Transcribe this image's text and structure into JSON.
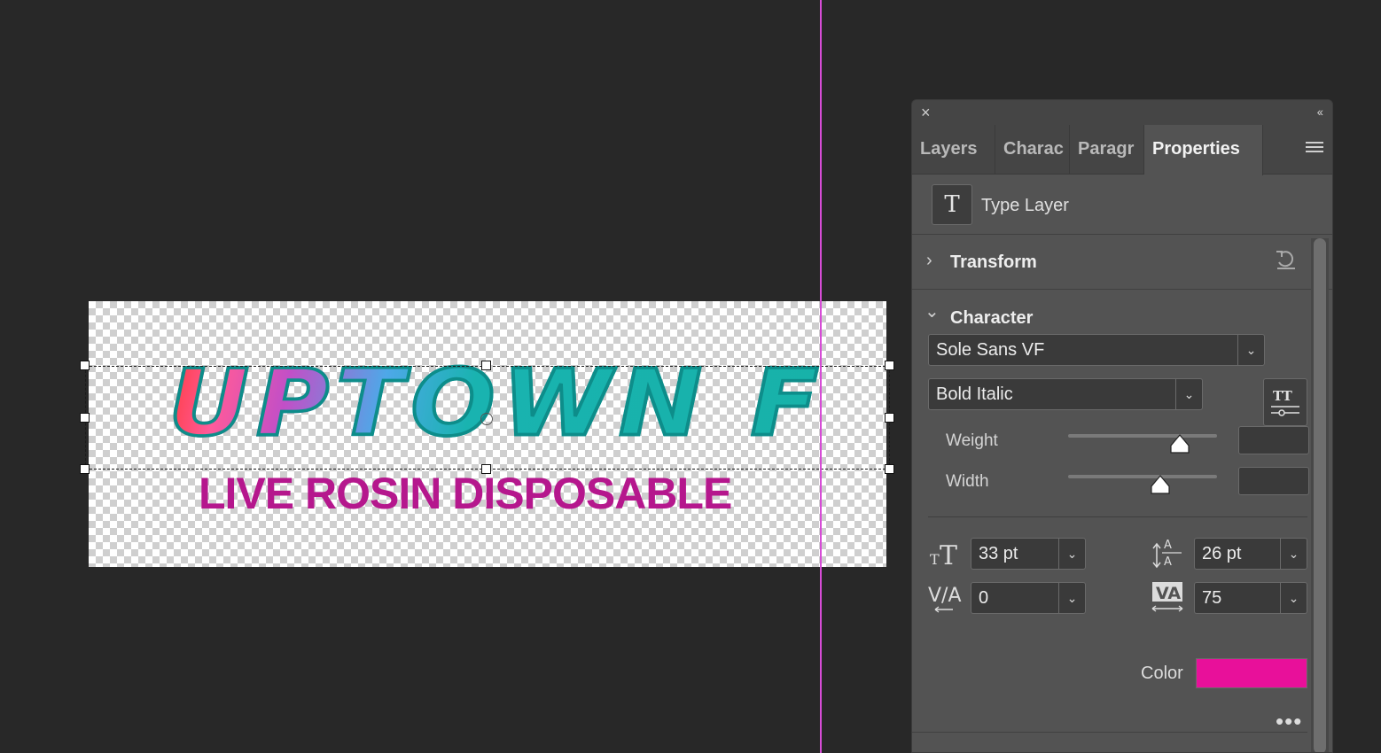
{
  "canvas": {
    "headline_text": "UPTOWN F",
    "subline_text": "LIVE ROSIN DISPOSABLE",
    "guide_color": "#d64cd6"
  },
  "panel": {
    "close_icon": "×",
    "collapse_icon": "‹‹",
    "tabs": [
      {
        "label": "Layers"
      },
      {
        "label": "Charac"
      },
      {
        "label": "Paragr"
      },
      {
        "label": "Properties"
      }
    ],
    "layer_type_icon": "T",
    "layer_type_label": "Type Layer",
    "transform": {
      "title": "Transform",
      "chevron": "›"
    },
    "character": {
      "title": "Character",
      "chevron": "⌄",
      "font_family": "Sole Sans VF",
      "font_style": "Bold Italic",
      "sliders": [
        {
          "label": "Weight",
          "value_fraction": 0.75
        },
        {
          "label": "Width",
          "value_fraction": 0.62
        }
      ],
      "font_size": "33 pt",
      "leading": "26 pt",
      "kerning": "0",
      "tracking": "75",
      "color_label": "Color",
      "color_value": "#e8109a",
      "more_label": "•••"
    }
  }
}
